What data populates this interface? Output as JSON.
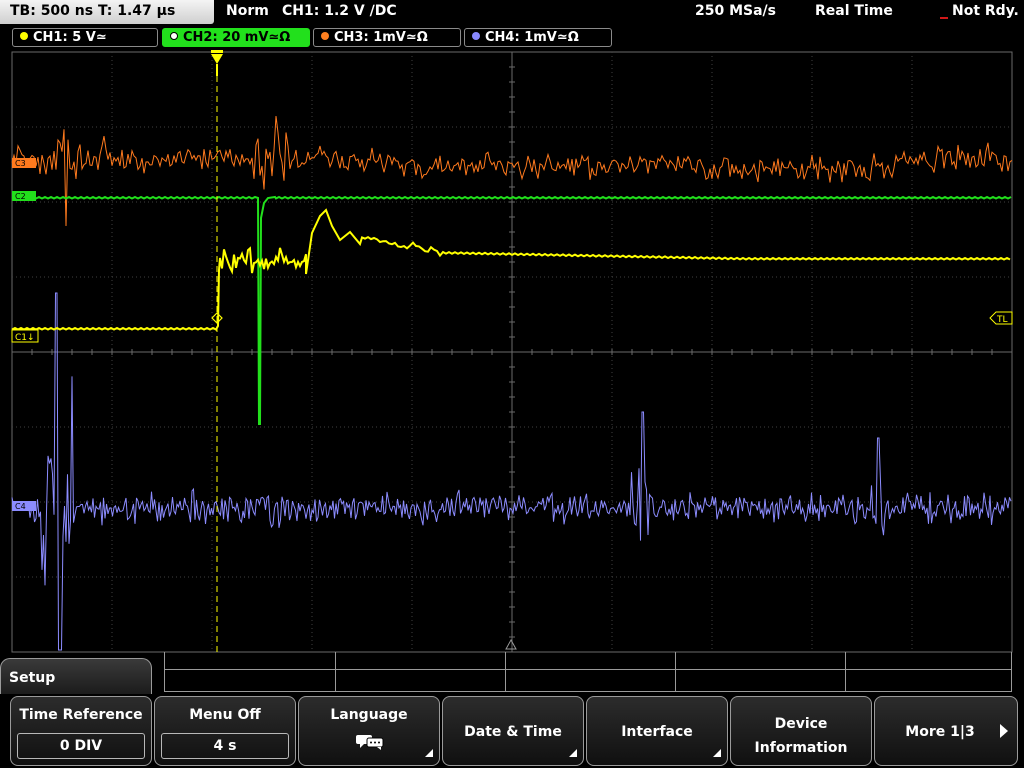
{
  "header": {
    "timebase": "TB: 500 ns   T: 1.47 µs",
    "trigger_mode": "Norm",
    "trigger_info": "CH1: 1.2 V ∕DC",
    "sample_rate": "250 MSa/s",
    "acq_mode": "Real Time",
    "status": "Not Rdy."
  },
  "channels": [
    {
      "label": "CH1: 5 V≃",
      "color": "#ffff00",
      "active": false
    },
    {
      "label": "CH2: 20 mV≃Ω",
      "color": "#22e01c",
      "active": true
    },
    {
      "label": "CH3: 1mV≃Ω",
      "color": "#ff8020",
      "active": false
    },
    {
      "label": "CH4: 1mV≃Ω",
      "color": "#8888ff",
      "active": false
    }
  ],
  "markers": {
    "ch1_ref": "C1↓",
    "trigger_level": "TL",
    "ch2_ref": "C2",
    "ch3_ref": "C3",
    "ch4_ref": "C4"
  },
  "colors": {
    "ch1": "#ffff00",
    "ch2": "#22e01c",
    "ch3": "#ff7a1e",
    "ch4": "#8c8cff",
    "grid": "#6a6a6a"
  },
  "menu": {
    "title": "Setup",
    "softkeys": [
      {
        "title": "Time Reference",
        "value": "0 DIV"
      },
      {
        "title": "Menu Off",
        "value": "4 s"
      },
      {
        "title": "Language",
        "icon": "chat-bubbles-icon"
      },
      {
        "title": "Date & Time"
      },
      {
        "title": "Interface"
      },
      {
        "title": "Device Information"
      },
      {
        "title": "More 1|3"
      }
    ]
  }
}
